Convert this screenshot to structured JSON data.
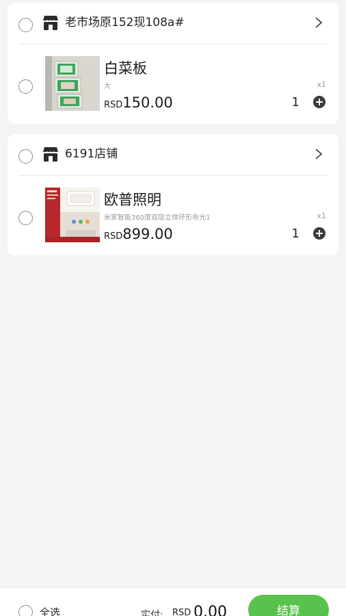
{
  "shops": [
    {
      "name": "老市场原152现108a#",
      "item": {
        "title": "白菜板",
        "spec": "大",
        "multiplier": "x1",
        "currency": "RSD",
        "price": "150.00",
        "quantity": "1"
      }
    },
    {
      "name": "6191店铺",
      "item": {
        "title": "欧普照明",
        "spec": "米家智能360度双层立体环形布光1",
        "multiplier": "x1",
        "currency": "RSD",
        "price": "899.00",
        "quantity": "1"
      }
    }
  ],
  "footer": {
    "select_all": "全选",
    "total_label": "实付:",
    "currency": "RSD",
    "total": "0.00",
    "checkout": "结算"
  },
  "colors": {
    "accent": "#59c24c",
    "background": "#f4f4f4"
  }
}
